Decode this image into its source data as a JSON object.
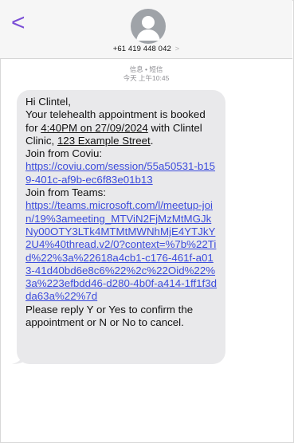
{
  "header": {
    "back_label": "<",
    "contact_number": "+61 419 448 042",
    "contact_chevron": ">"
  },
  "meta": {
    "line1": "信息 • 短信",
    "line2": "今天 上午10:45"
  },
  "message": {
    "greeting": "Hi Clintel,",
    "line_a": "Your telehealth appointment is booked",
    "line_b_pre": "for ",
    "time": "4:40PM on 27/09/2024",
    "line_b_post": " with Clintel",
    "line_c_pre": "Clinic, ",
    "street": "123 Example Street",
    "line_c_post": ".",
    "join_coviu": "Join from Coviu:",
    "coviu_link": "https://coviu.com/session/55a50531-b159-401c-af9b-ec6f83e01b13",
    "join_teams": "Join from Teams:",
    "teams_link": "https://teams.microsoft.com/l/meetup-join/19%3ameeting_MTViN2FjMzMtMGJkNy00OTY3LTk4MTMtMWNhMjE4YTJkY2U4%40thread.v2/0?context=%7b%22Tid%22%3a%22618a4cb1-c176-461f-a013-41d40bd6e8c6%22%2c%22Oid%22%3a%223efbdd46-d280-4b0f-a414-1ff1f3dda63a%22%7d",
    "reply": " Please reply Y or Yes to confirm the appointment or N or No to cancel."
  },
  "colors": {
    "accent": "#7b4fd6",
    "link": "#3b4bdc",
    "bubble": "#e9e9eb"
  },
  "icons": {
    "back": "chevron-left-icon",
    "avatar": "person-avatar-icon"
  }
}
